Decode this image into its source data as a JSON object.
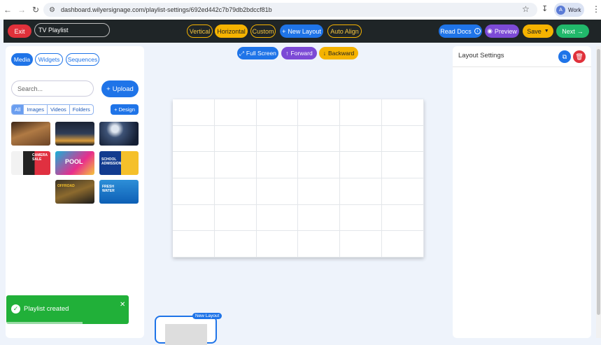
{
  "browser": {
    "url": "dashboard.wilyersignage.com/playlist-settings/692ed442c7b79db2bdccf81b",
    "profile_initial": "A",
    "profile_label": "Work"
  },
  "toolbar": {
    "exit": "Exit",
    "playlist_name": "TV Playlist",
    "layouts": [
      "Vertical",
      "Horizontal",
      "Custom"
    ],
    "active_layout": "Horizontal",
    "new_layout": "New Layout",
    "auto_align": "Auto Align",
    "read_docs": "Read Docs",
    "preview": "Preview",
    "save": "Save",
    "next": "Next"
  },
  "sidebar": {
    "tabs": [
      "Media",
      "Widgets",
      "Sequences"
    ],
    "active_tab": "Media",
    "search_placeholder": "Search...",
    "upload": "Upload",
    "filters": [
      "All",
      "Images",
      "Videos",
      "Folders"
    ],
    "active_filter": "All",
    "design": "Design",
    "media": [
      {
        "name": "restaurant-image"
      },
      {
        "name": "city-night-image"
      },
      {
        "name": "moon-landscape-image"
      },
      {
        "name": "sale-ad-image",
        "text": "CAMERA SALE"
      },
      {
        "name": "pool-ad-image",
        "text": "POOL"
      },
      {
        "name": "school-admission-image",
        "text": "SCHOOL ADMISSION"
      },
      {
        "name": "offroad-ad-image",
        "text": "OFFROAD"
      },
      {
        "name": "fresh-water-image",
        "text": "FRESH WATER"
      }
    ]
  },
  "canvas_controls": {
    "full_screen": "Full Screen",
    "forward": "Forward",
    "backward": "Backward"
  },
  "right_panel": {
    "title": "Layout Settings"
  },
  "toast": {
    "message": "Playlist created",
    "progress": 0.62
  },
  "layout_card": {
    "badge": "New Layout"
  },
  "colors": {
    "primary": "#1f74e8",
    "accent": "#f5b300",
    "danger": "#e0313b",
    "success": "#21b86b",
    "purple": "#7c4ad6"
  }
}
